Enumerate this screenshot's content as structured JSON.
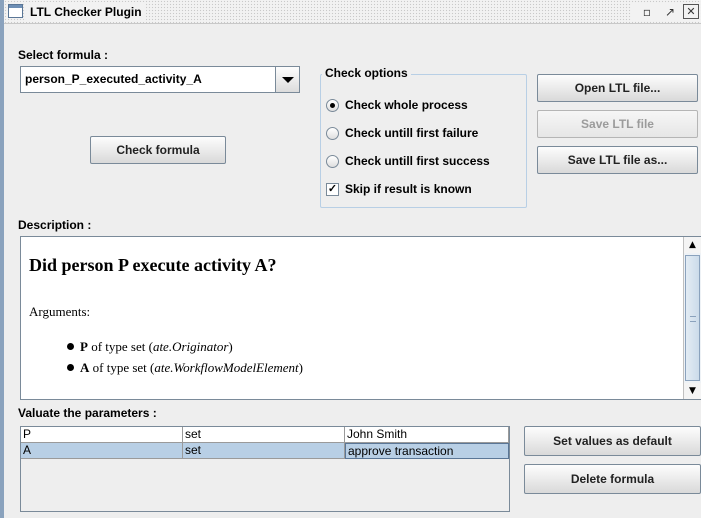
{
  "window": {
    "title": "LTL Checker Plugin",
    "buttons": {
      "minimize": "▫",
      "maximize": "↗",
      "close": "✕"
    }
  },
  "formula": {
    "label": "Select formula :",
    "selected": "person_P_executed_activity_A",
    "check_button": "Check formula"
  },
  "check_options": {
    "title": "Check options",
    "options": [
      {
        "label": "Check whole process",
        "selected": true
      },
      {
        "label": "Check untill first failure",
        "selected": false
      },
      {
        "label": "Check untill first success",
        "selected": false
      }
    ],
    "skip": {
      "label": "Skip if result is known",
      "checked": true
    }
  },
  "file_buttons": {
    "open": "Open LTL file...",
    "save": "Save LTL file",
    "save_as": "Save LTL file as..."
  },
  "description": {
    "label": "Description :",
    "heading": "Did person P execute activity A?",
    "arguments_label": "Arguments:",
    "arguments": [
      {
        "name": "P",
        "text": " of type set (",
        "type": "ate.Originator",
        "close": ")"
      },
      {
        "name": "A",
        "text": " of type set (",
        "type": "ate.WorkflowModelElement",
        "close": ")"
      }
    ]
  },
  "parameters": {
    "label": "Valuate the parameters :",
    "rows": [
      {
        "name": "P",
        "type": "set",
        "value": "John Smith",
        "selected": false
      },
      {
        "name": "A",
        "type": "set",
        "value": "approve transaction",
        "selected": true
      }
    ],
    "set_default_button": "Set values as default",
    "delete_button": "Delete formula"
  }
}
